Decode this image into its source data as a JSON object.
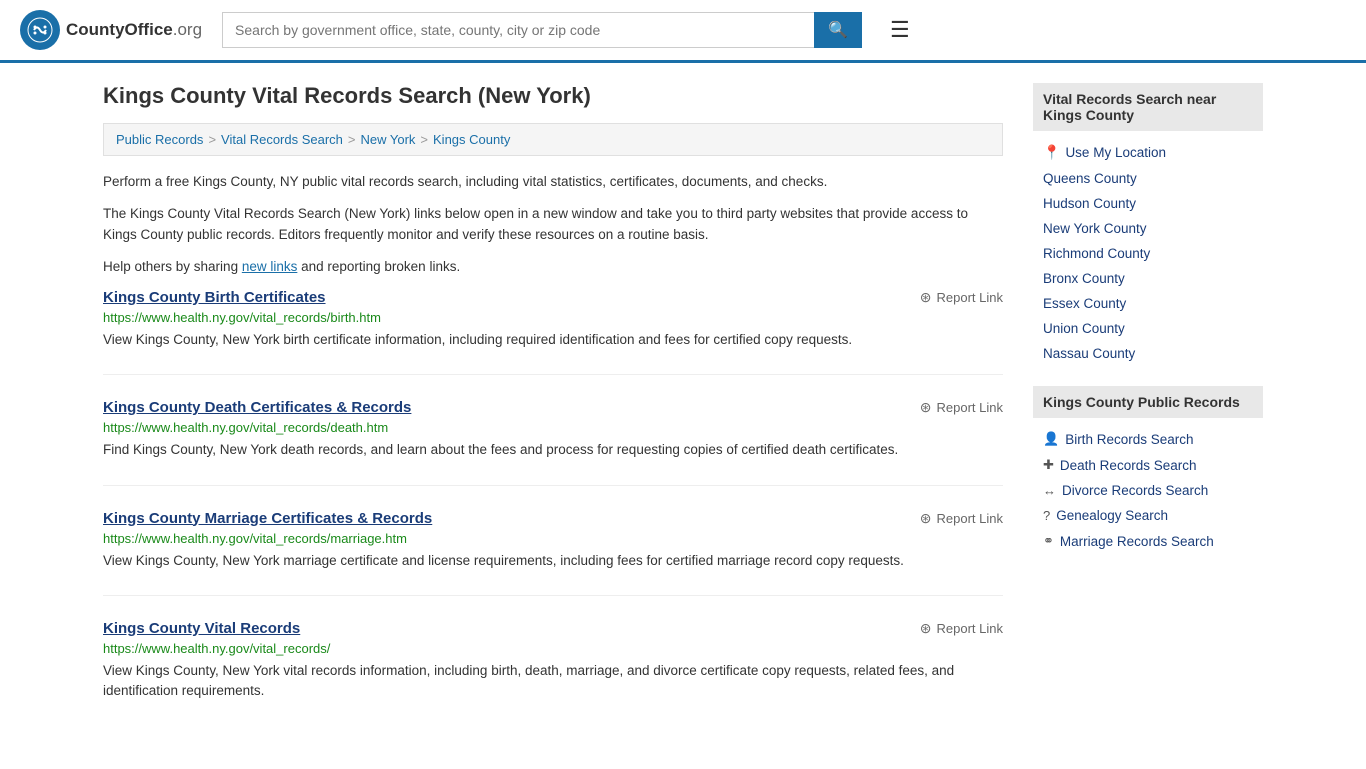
{
  "header": {
    "logo_letter": "✦",
    "logo_name": "CountyOffice",
    "logo_suffix": ".org",
    "search_placeholder": "Search by government office, state, county, city or zip code",
    "search_value": ""
  },
  "page": {
    "title": "Kings County Vital Records Search (New York)",
    "breadcrumb": [
      {
        "label": "Public Records",
        "href": "#"
      },
      {
        "label": "Vital Records Search",
        "href": "#"
      },
      {
        "label": "New York",
        "href": "#"
      },
      {
        "label": "Kings County",
        "href": "#"
      }
    ],
    "desc1": "Perform a free Kings County, NY public vital records search, including vital statistics, certificates, documents, and checks.",
    "desc2_prefix": "The Kings County Vital Records Search (New York) links below open in a new window and take you to third party websites that provide access to Kings County public records. Editors frequently monitor and verify these resources on a routine basis.",
    "desc3_prefix": "Help others by sharing ",
    "desc3_link": "new links",
    "desc3_suffix": " and reporting broken links.",
    "results": [
      {
        "title": "Kings County Birth Certificates",
        "url": "https://www.health.ny.gov/vital_records/birth.htm",
        "desc": "View Kings County, New York birth certificate information, including required identification and fees for certified copy requests."
      },
      {
        "title": "Kings County Death Certificates & Records",
        "url": "https://www.health.ny.gov/vital_records/death.htm",
        "desc": "Find Kings County, New York death records, and learn about the fees and process for requesting copies of certified death certificates."
      },
      {
        "title": "Kings County Marriage Certificates & Records",
        "url": "https://www.health.ny.gov/vital_records/marriage.htm",
        "desc": "View Kings County, New York marriage certificate and license requirements, including fees for certified marriage record copy requests."
      },
      {
        "title": "Kings County Vital Records",
        "url": "https://www.health.ny.gov/vital_records/",
        "desc": "View Kings County, New York vital records information, including birth, death, marriage, and divorce certificate copy requests, related fees, and identification requirements."
      }
    ],
    "report_label": "Report Link"
  },
  "sidebar": {
    "nearby_heading": "Vital Records Search near Kings County",
    "use_my_location": "Use My Location",
    "nearby_counties": [
      "Queens County",
      "Hudson County",
      "New York County",
      "Richmond County",
      "Bronx County",
      "Essex County",
      "Union County",
      "Nassau County"
    ],
    "public_records_heading": "Kings County Public Records",
    "public_records_links": [
      {
        "icon": "👤",
        "label": "Birth Records Search"
      },
      {
        "icon": "✚",
        "label": "Death Records Search"
      },
      {
        "icon": "↔",
        "label": "Divorce Records Search"
      },
      {
        "icon": "?",
        "label": "Genealogy Search"
      },
      {
        "icon": "⚭",
        "label": "Marriage Records Search"
      }
    ]
  }
}
